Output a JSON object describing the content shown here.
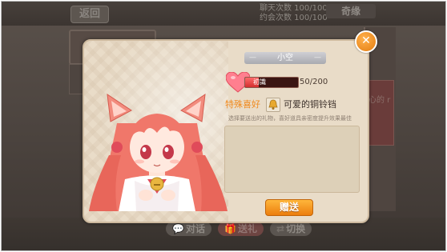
{
  "background": {
    "back_label": "返回",
    "stats": [
      "聊天次数 100/100",
      "约会次数 100/100"
    ],
    "top_tab": "奇缘",
    "right_card_text": "心的 r",
    "bottom_buttons": [
      {
        "icon": "speech-bubble-icon",
        "label": "对话"
      },
      {
        "icon": "gift-icon",
        "label": "送礼"
      },
      {
        "icon": "swap-icon",
        "label": "切换"
      }
    ]
  },
  "dialog": {
    "character_name": "小空",
    "affection": {
      "level_label": "初識",
      "current": 50,
      "max": 200,
      "display": "50/200",
      "fraction": 0.25
    },
    "favorite_label": "特殊喜好",
    "favorite_item": "可爱的铜铃铛",
    "hint": "选择要送出的礼物，喜好道具亲密度提升效果最佳",
    "give_button": "赠送",
    "close_icon": "close-icon"
  },
  "colors": {
    "accent_orange": "#ec7d0d",
    "favorite_text": "#f08a1e",
    "affection_fill": "#d22f2f"
  }
}
